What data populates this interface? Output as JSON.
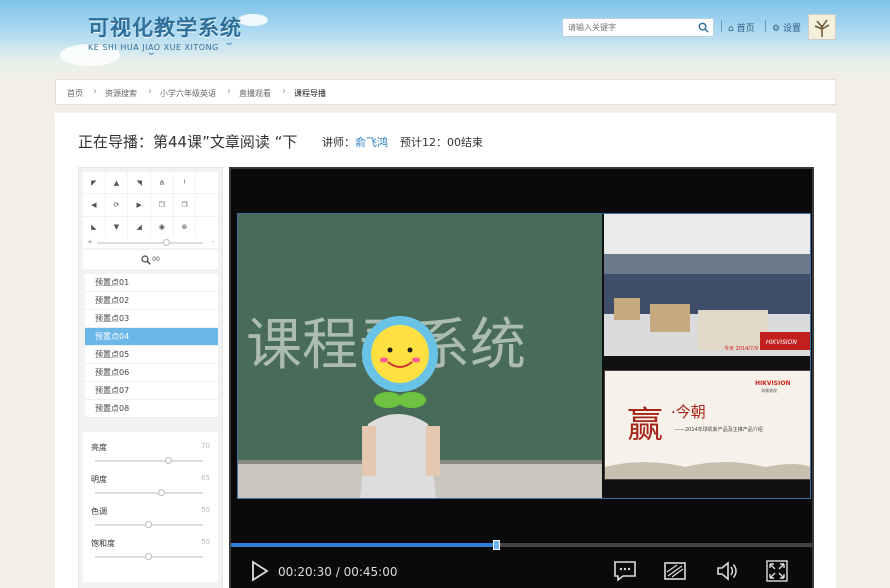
{
  "header": {
    "logo_title": "可视化教学系统",
    "logo_subtitle": "KE SHI HUA JIAO XUE XITONG",
    "search_placeholder": "请输入关键字",
    "home_label": "首页",
    "settings_label": "设置"
  },
  "breadcrumb": [
    "首页",
    "资源搜索",
    "小学六年级英语",
    "直播观看",
    "课程导播"
  ],
  "course": {
    "title": "正在导播：第44课”文章阅读 “下",
    "teacher_label": "讲师：",
    "teacher_name": "俞飞鸿",
    "end_time": "预计12：00结束"
  },
  "zoom_label": "00",
  "presets": [
    "预置点01",
    "预置点02",
    "预置点03",
    "预置点04",
    "预置点05",
    "预置点06",
    "预置点07",
    "预置点08"
  ],
  "active_preset_index": 3,
  "adjustments": [
    {
      "label": "亮度",
      "value": "70"
    },
    {
      "label": "明度",
      "value": "65"
    },
    {
      "label": "色调",
      "value": "50"
    },
    {
      "label": "饱和度",
      "value": "50"
    }
  ],
  "player": {
    "current_time": "00:20:30",
    "total_time": "00:45:00",
    "time_display": "00:20:30 / 00:45:00",
    "progress_fraction": 0.4556,
    "chalk_text": "课程录系统",
    "hall_date": "今天 2014/7/9",
    "hall_brand": "HIKVISION",
    "slide_brand": "HIKVISION",
    "slide_brand_cn": "海康威视",
    "slide_big_char": "赢",
    "slide_title": "·今朝",
    "slide_subtitle": "——2014年球机新产品及主推产品介绍"
  },
  "colors": {
    "accent": "#6bb7e8",
    "progress": "#2e7ed6",
    "brand": "#2e6f9a"
  }
}
